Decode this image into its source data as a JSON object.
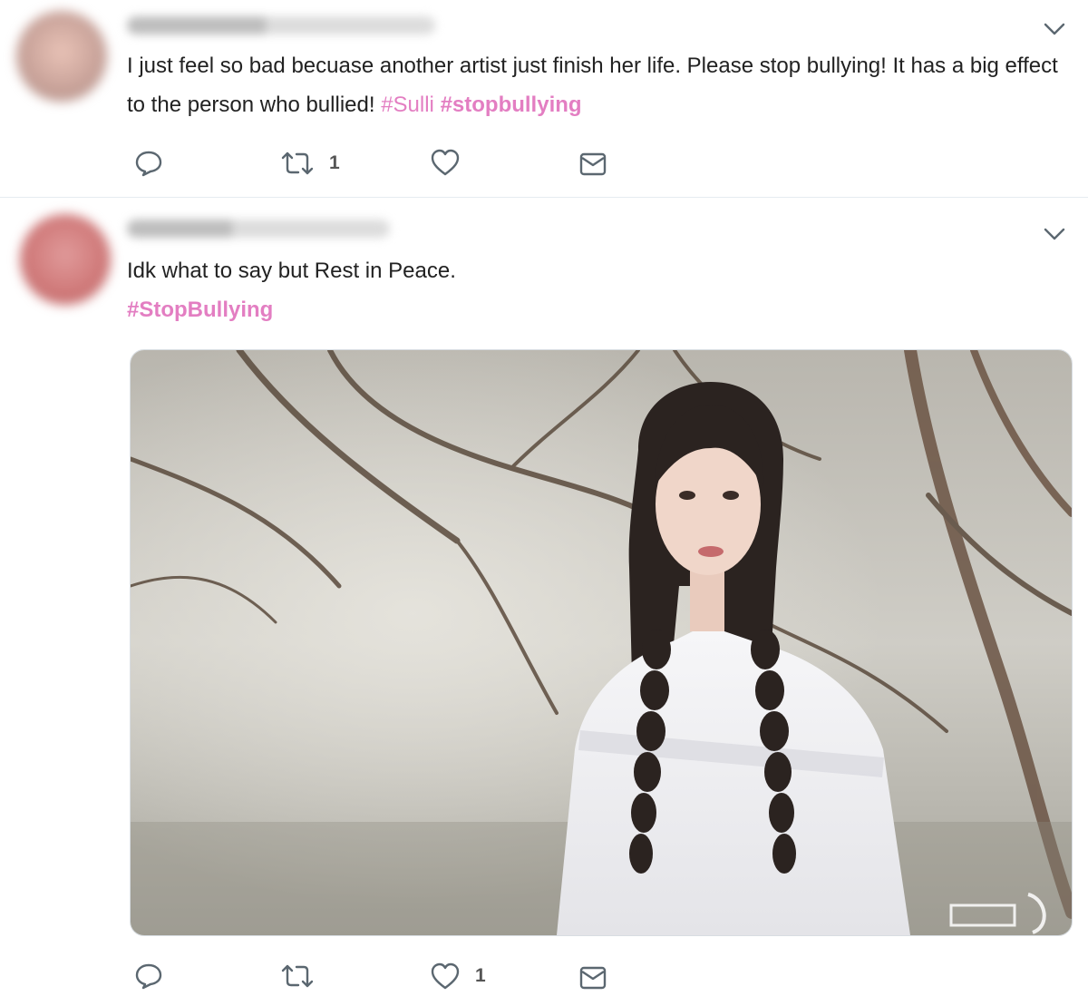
{
  "colors": {
    "hashtag": "#e37ec2",
    "icon": "#5b6770",
    "divider": "#e6ecf0"
  },
  "tweets": [
    {
      "avatar_color": "#c9a39a",
      "text_plain": "I just feel so bad becuase another artist just finish her life. Please stop bullying! It has a big effect to the person who bullied!",
      "hashtags": [
        "#Sulli",
        "#stopbullying"
      ],
      "actions": {
        "reply_icon": "reply-icon",
        "retweet_icon": "retweet-icon",
        "retweet_count": "1",
        "like_icon": "heart-icon",
        "like_count": "",
        "message_icon": "envelope-icon"
      }
    },
    {
      "avatar_color": "#d07a7a",
      "text_plain": "Idk what to say but Rest in Peace.",
      "hashtags": [
        "#StopBullying"
      ],
      "media_icon": "photo-woman-with-braids-in-forest",
      "media_watermark": "logo-watermark",
      "actions": {
        "reply_icon": "reply-icon",
        "retweet_icon": "retweet-icon",
        "retweet_count": "",
        "like_icon": "heart-icon",
        "like_count": "1",
        "message_icon": "envelope-icon"
      }
    }
  ]
}
